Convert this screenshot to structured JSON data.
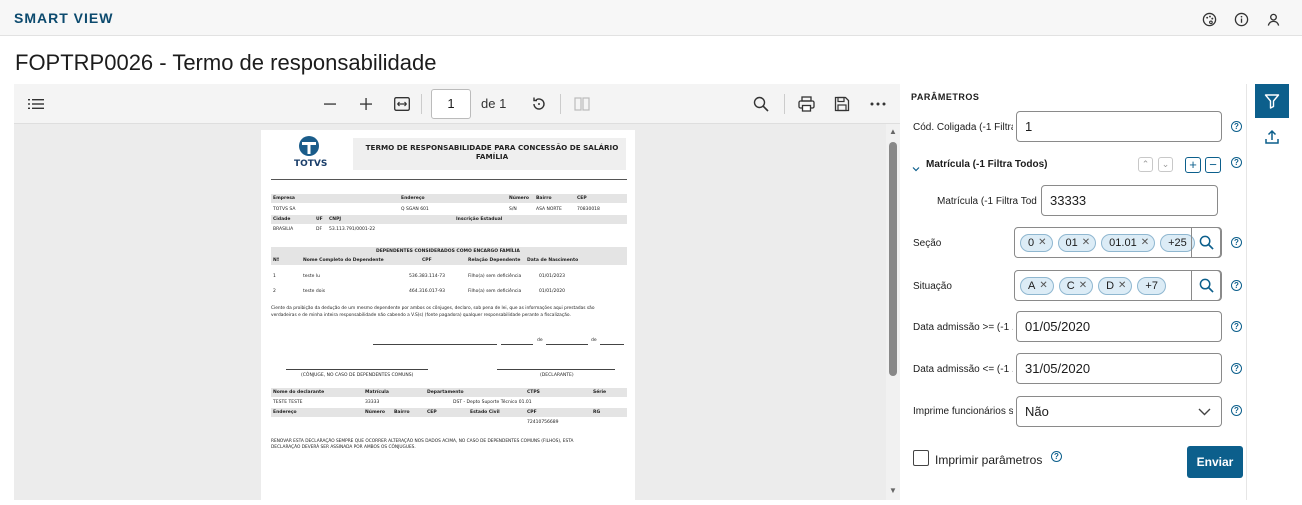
{
  "app": {
    "brand": "SMART VIEW"
  },
  "header_icons": [
    "palette-icon",
    "info-icon",
    "user-icon"
  ],
  "page": {
    "title": "FOPTRP0026 - Termo de responsabilidade"
  },
  "viewer": {
    "current_page": "1",
    "page_of": "de 1"
  },
  "document": {
    "logo_text": "TOTVS",
    "heading": "TERMO DE RESPONSABILIDADE PARA CONCESSÃO DE SALÁRIO FAMÍLIA",
    "company_headers": {
      "empresa": "Empresa",
      "endereco": "Endereço",
      "numero": "Número",
      "bairro": "Bairro",
      "cep": "CEP"
    },
    "company_values": {
      "empresa": "TOTVS SA",
      "endereco": "Q SGAN 601",
      "numero": "S/N",
      "bairro": "ASA NORTE",
      "cep": "70830018"
    },
    "city_headers": {
      "cidade": "Cidade",
      "uf": "UF",
      "cnpj": "CNPJ",
      "ie": "Inscrição Estadual"
    },
    "city_values": {
      "cidade": "BRASILIA",
      "uf": "DF",
      "cnpj": "53.113.791/0001-22"
    },
    "dependents_title": "DEPENDENTES CONSIDERADOS COMO ENCARGO FAMÍLIA",
    "dependents_headers": {
      "n": "Nº",
      "nome": "Nome Completo do Dependente",
      "cpf": "CPF",
      "relacao": "Relação Dependente",
      "nasc": "Data de Nascimento"
    },
    "dependents": [
      {
        "n": "1",
        "nome": "teste lu",
        "cpf": "536.383.114-73",
        "relacao": "Filho(a) sem deficiência",
        "nasc": "01/01/2023"
      },
      {
        "n": "2",
        "nome": "teste dois",
        "cpf": "464.316.017-93",
        "relacao": "Filho(a) sem deficiência",
        "nasc": "01/01/2020"
      }
    ],
    "paragraph_line1": "Ciente da proibição da dedução de um mesmo dependente por ambos os cônjuges, declaro, sob pena de lei, que as informações aqui prestadas são",
    "paragraph_line2": "verdadeiras e de minha inteira responsabilidade não cabendo a V.S(s) (fonte pagadora) qualquer responsabilidade perante a fiscalização.",
    "date_line_de1": "de",
    "date_line_de2": "de",
    "sig_conjuge": "(CÔNJUGE, NO CASO DE DEPENDENTES COMUNS)",
    "sig_declarante": "(DECLARANTE)",
    "decl_headers": {
      "nome": "Nome do declarante",
      "matricula": "Matrícula",
      "departamento": "Departamento",
      "ctps": "CTPS",
      "serie": "Série"
    },
    "decl_values": {
      "nome": "TESTE TESTE",
      "matricula": "33333",
      "departamento": "DST - Depto Suporte Técnico 01.01"
    },
    "addr_headers": {
      "endereco": "Endereço",
      "numero": "Número",
      "bairro": "Bairro",
      "cep": "CEP",
      "estado_civil": "Estado Civil",
      "cpf": "CPF",
      "rg": "RG"
    },
    "addr_values": {
      "cpf": "72410756689"
    },
    "footer_line1": "RENOVAR ESTA DECLARAÇÃO SEMPRE QUE OCORRER ALTERAÇÃO NOS DADOS ACIMA, NO CASO DE DEPENDENTES COMUNS (FILHOS), ESTA",
    "footer_line2": "DECLARAÇÃO DEVERÁ SER ASSINADA POR AMBOS OS CÔNJUGUES."
  },
  "params": {
    "title": "PARÂMETROS",
    "coligada": {
      "label": "Cód. Coligada (-1 Filtra...",
      "value": "1"
    },
    "matricula_group": {
      "label": "Matrícula (-1 Filtra Todos)"
    },
    "matricula": {
      "label": "Matrícula (-1 Filtra Todo...",
      "value": "33333"
    },
    "secao": {
      "label": "Seção",
      "chips": [
        "0",
        "01",
        "01.01"
      ],
      "more": "+25"
    },
    "situacao": {
      "label": "Situação",
      "chips": [
        "A",
        "C",
        "D"
      ],
      "more": "+7"
    },
    "data_admissao_ini": {
      "label": "Data admissão >= (-1 ...",
      "value": "01/05/2020"
    },
    "data_admissao_fim": {
      "label": "Data admissão <= (-1 ...",
      "value": "31/05/2020"
    },
    "imprime_func": {
      "label": "Imprime funcionários s...",
      "value": "Não"
    },
    "imprimir_parametros": "Imprimir parâmetros",
    "submit_label": "Enviar"
  }
}
